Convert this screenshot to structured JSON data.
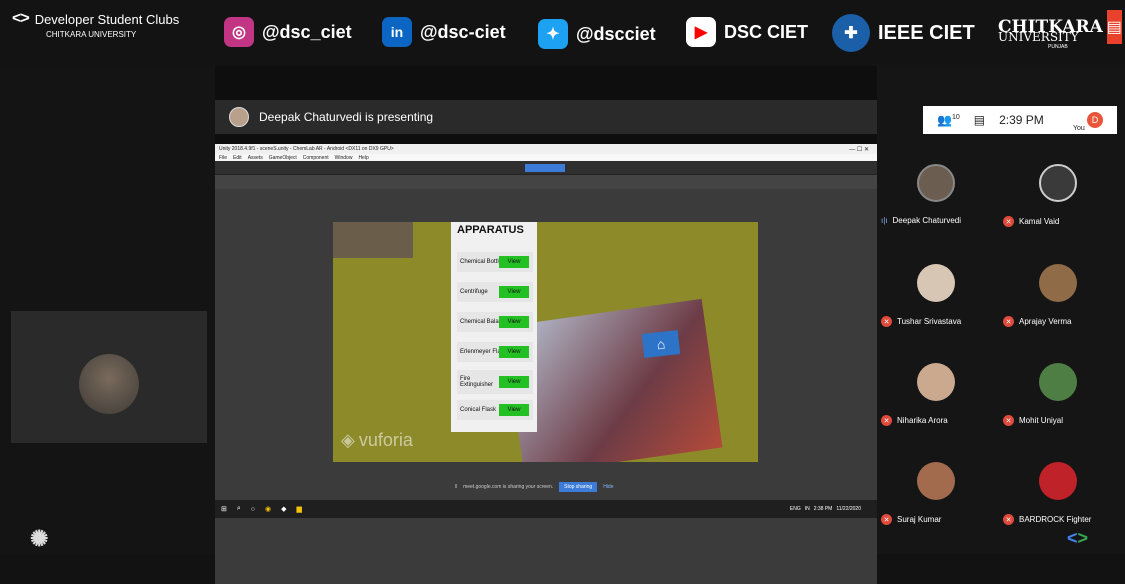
{
  "banner": {
    "org_name": "Developer Student Clubs",
    "org_sub": "CHITKARA UNIVERSITY",
    "socials": [
      {
        "icon": "instagram-icon",
        "label": "@dsc_ciet",
        "color": "#c13584"
      },
      {
        "icon": "linkedin-icon",
        "label": "@dsc-ciet",
        "color": "#0a66c2"
      },
      {
        "icon": "twitter-icon",
        "label": "@dscciet",
        "color": "#1da1f2"
      },
      {
        "icon": "youtube-icon",
        "label": "DSC CIET",
        "color": "#ff0000"
      },
      {
        "icon": "ieee-icon",
        "label": "IEEE CIET",
        "color": "#1b5fa8"
      }
    ],
    "university_name": "CHITKARA",
    "university_sub": "UNIVERSITY",
    "university_region": "PUNJAB"
  },
  "presenter": {
    "text": "Deepak Chaturvedi is presenting"
  },
  "meet_bar": {
    "participants_count": "10",
    "time": "2:39 PM",
    "you_label": "You",
    "you_initial": "D"
  },
  "unity": {
    "title": "Unity 2018.4.9f1 - sceneS.unity - ChemLab AR - Android <DX11 on DX9 GPU>",
    "menu": [
      "File",
      "Edit",
      "Assets",
      "GameObject",
      "Component",
      "Window",
      "Help"
    ]
  },
  "game": {
    "heading": "APPARATUS",
    "items": [
      {
        "label": "Chemical Bottles",
        "button": "View"
      },
      {
        "label": "Centrifuge",
        "button": "View"
      },
      {
        "label": "Chemical Balance",
        "button": "View"
      },
      {
        "label": "Erlenmeyer Flask",
        "button": "View"
      },
      {
        "label": "Fire Extinguisher",
        "button": "View"
      },
      {
        "label": "Conical Flask",
        "button": "View"
      }
    ],
    "watermark": "vuforia"
  },
  "share_bar": {
    "text": "meet.google.com is sharing your screen.",
    "stop_label": "Stop sharing",
    "hide_label": "Hide"
  },
  "taskbar": {
    "lang": "ENG",
    "region": "IN",
    "time": "2:38 PM",
    "date": "11/22/2020"
  },
  "participants": [
    {
      "name": "Deepak Chaturvedi",
      "muted": false,
      "color": "#6b5d4f"
    },
    {
      "name": "Kamal Vaid",
      "muted": true,
      "color": "#3a3a3a"
    },
    {
      "name": "Tushar Srivastava",
      "muted": true,
      "color": "#d8c6b4"
    },
    {
      "name": "Aprajay Verma",
      "muted": true,
      "color": "#8f6b48"
    },
    {
      "name": "Niharika Arora",
      "muted": true,
      "color": "#caa98e"
    },
    {
      "name": "Mohit Uniyal",
      "muted": true,
      "color": "#4e7e44"
    },
    {
      "name": "Suraj Kumar",
      "muted": true,
      "color": "#a26b4e"
    },
    {
      "name": "BARDROCK Fighter",
      "muted": true,
      "color": "#c0222a"
    }
  ]
}
